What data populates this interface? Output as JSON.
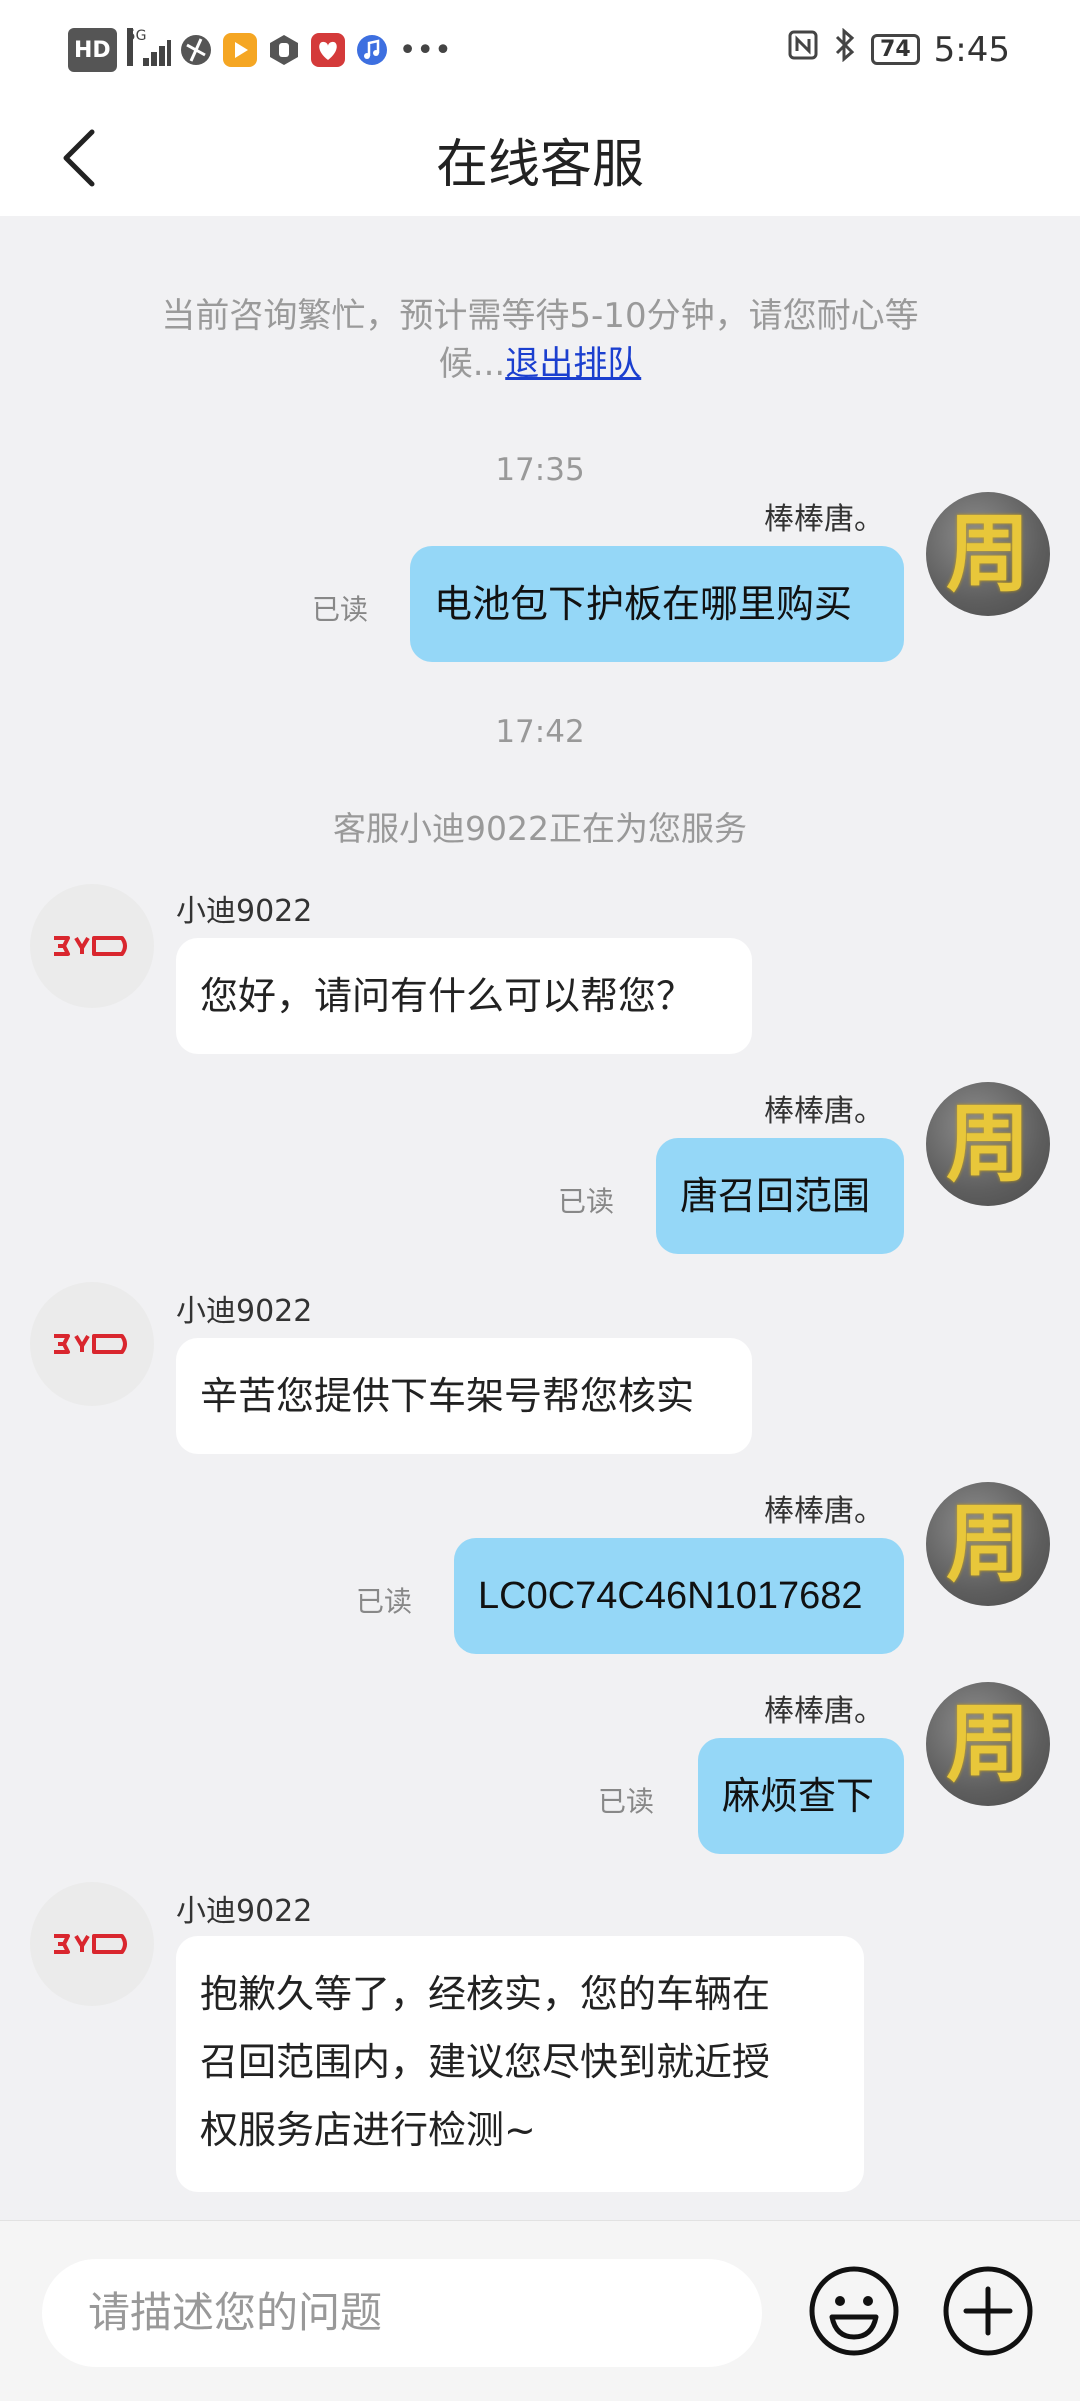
{
  "status_bar": {
    "hd": "HD",
    "network": "5G",
    "battery": "74",
    "time": "5:45"
  },
  "header": {
    "title": "在线客服"
  },
  "chat": {
    "notice_text": "当前咨询繁忙，预计需等待5-10分钟，请您耐心等候...",
    "notice_link": "退出排队",
    "time1": "17:35",
    "time2": "17:42",
    "system_msg": "客服小迪9022正在为您服务",
    "user_name": "棒棒唐。",
    "agent_name": "小迪9022",
    "read_label": "已读",
    "agent_logo_text": "BYD",
    "user_avatar_glyph": "周",
    "messages": [
      {
        "from": "user",
        "text": "电池包下护板在哪里购买"
      },
      {
        "from": "agent",
        "text": "您好，请问有什么可以帮您？"
      },
      {
        "from": "user",
        "text": "唐召回范围"
      },
      {
        "from": "agent",
        "text": "辛苦您提供下车架号帮您核实"
      },
      {
        "from": "user",
        "text": "LC0C74C46N1017682"
      },
      {
        "from": "user",
        "text": "麻烦查下"
      },
      {
        "from": "agent",
        "lines": [
          "抱歉久等了，经核实，您的车辆在",
          "召回范围内，建议您尽快到就近授",
          "权服务店进行检测~"
        ]
      }
    ]
  },
  "input_bar": {
    "placeholder": "请描述您的问题"
  },
  "colors": {
    "user_bubble": "#95d7f7",
    "agent_bubble": "#ffffff",
    "background": "#f1f1f3",
    "link": "#1b3fcf",
    "byd_red": "#d9262e"
  }
}
